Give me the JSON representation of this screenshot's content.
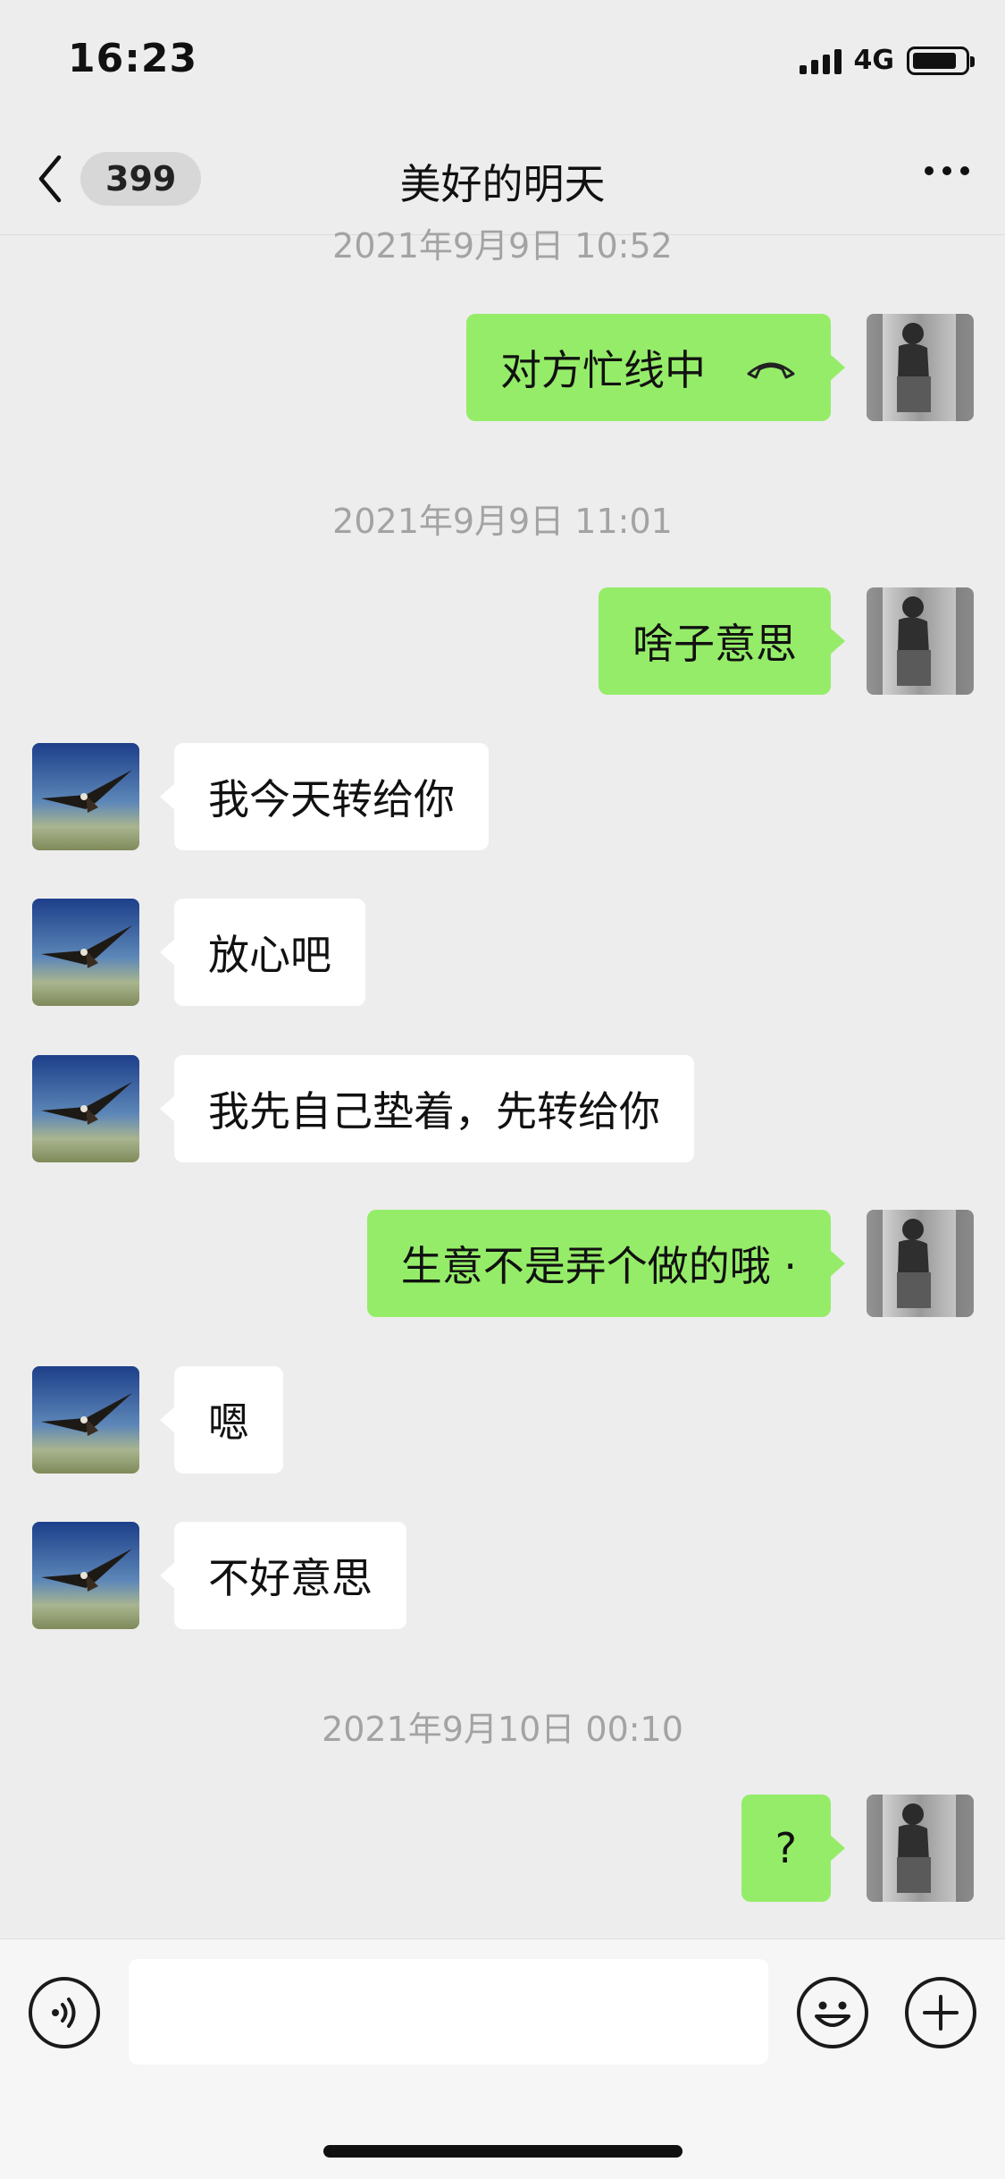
{
  "status_bar": {
    "time": "16:23",
    "network": "4G"
  },
  "header": {
    "back_count": "399",
    "title": "美好的明天",
    "more_icon": "more-dots-icon"
  },
  "timestamps": [
    "2021年9月9日 10:52",
    "2021年9月9日 11:01",
    "2021年9月10日 00:10"
  ],
  "messages": [
    {
      "side": "right",
      "text": "对方忙线中",
      "icon": "phone-hangup-icon"
    },
    {
      "side": "right",
      "text": "啥子意思"
    },
    {
      "side": "left",
      "text": "我今天转给你"
    },
    {
      "side": "left",
      "text": "放心吧"
    },
    {
      "side": "left",
      "text": "我先自己垫着，先转给你"
    },
    {
      "side": "right",
      "text": "生意不是弄个做的哦 ·"
    },
    {
      "side": "left",
      "text": "嗯"
    },
    {
      "side": "left",
      "text": "不好意思"
    },
    {
      "side": "right",
      "text": "?"
    }
  ],
  "input_bar": {
    "voice_icon": "voice-icon",
    "emoji_icon": "emoji-icon",
    "plus_icon": "plus-icon",
    "input_value": ""
  },
  "colors": {
    "background": "#ededed",
    "bubble_mine": "#95ec69",
    "bubble_other": "#ffffff",
    "timestamp": "#a3a3a3"
  }
}
